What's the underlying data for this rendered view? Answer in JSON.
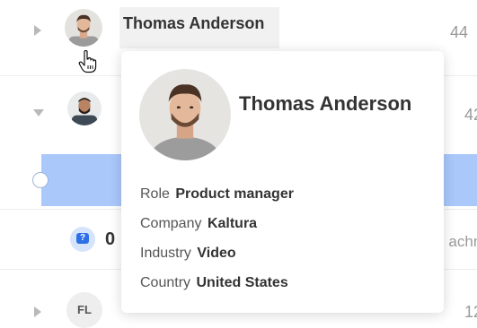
{
  "rows": [
    {
      "name": "Thomas Anderson",
      "count": "44"
    },
    {
      "count": "42"
    },
    {},
    {
      "prefix": "0",
      "attachment_partial": "achm"
    },
    {
      "initials": "FL",
      "count": "12"
    }
  ],
  "popover": {
    "name": "Thomas Anderson",
    "fields": [
      {
        "label": "Role",
        "value": "Product manager"
      },
      {
        "label": "Company",
        "value": "Kaltura"
      },
      {
        "label": "Industry",
        "value": "Video"
      },
      {
        "label": "Country",
        "value": "United States"
      }
    ]
  },
  "icons": {
    "chat": "chat-bubble-question-icon",
    "cursor": "hand-pointer-icon",
    "expand": "chevron-right-icon",
    "collapse": "chevron-down-icon"
  },
  "colors": {
    "selected_row": "#aac8fa",
    "badge_blue": "#2c6fe6"
  }
}
